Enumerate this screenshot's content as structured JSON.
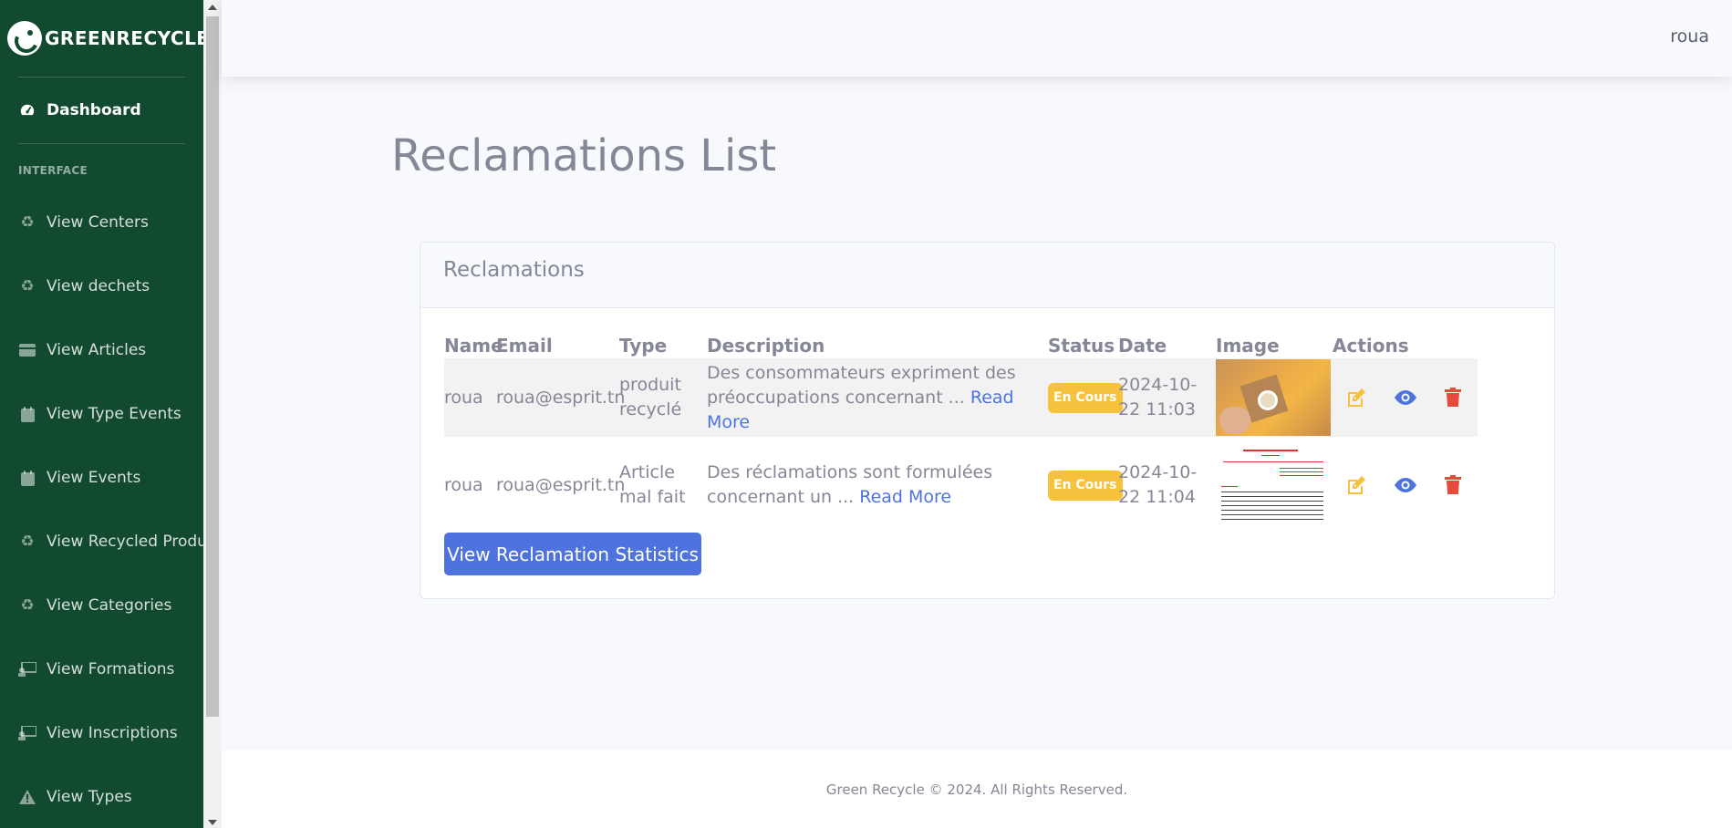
{
  "brand": {
    "name": "GREENRECYCLE"
  },
  "sidebar": {
    "dashboard": "Dashboard",
    "heading": "INTERFACE",
    "items": [
      {
        "label": "View Centers",
        "icon": "recycle-icon"
      },
      {
        "label": "View dechets",
        "icon": "recycle-icon"
      },
      {
        "label": "View Articles",
        "icon": "card-icon"
      },
      {
        "label": "View Type Events",
        "icon": "calendar-icon"
      },
      {
        "label": "View Events",
        "icon": "calendar-icon"
      },
      {
        "label": "View Recycled Products",
        "icon": "recycle-icon"
      },
      {
        "label": "View Categories",
        "icon": "recycle-icon"
      },
      {
        "label": "View Formations",
        "icon": "chalkboard-icon"
      },
      {
        "label": "View Inscriptions",
        "icon": "chalkboard-icon"
      },
      {
        "label": "View Types",
        "icon": "warning-icon"
      }
    ]
  },
  "topbar": {
    "user": "roua"
  },
  "page": {
    "title": "Reclamations List"
  },
  "card": {
    "title": "Reclamations",
    "columns": [
      "Name",
      "Email",
      "Type",
      "Description",
      "Status",
      "Date",
      "Image",
      "Actions"
    ],
    "rows": [
      {
        "name": "roua",
        "email": "roua@esprit.tn",
        "type": "produit recyclé",
        "description": "Des consommateurs expriment des préoccupations concernant ...",
        "read_more": "Read More",
        "status": "En Cours",
        "date": "2024-10-22 11:03"
      },
      {
        "name": "roua",
        "email": "roua@esprit.tn",
        "type": "Article mal fait",
        "description": "Des réclamations sont formulées concernant un ...",
        "read_more": "Read More",
        "status": "En Cours",
        "date": "2024-10-22 11:04"
      }
    ],
    "stats_button": "View Reclamation Statistics"
  },
  "footer": {
    "text": "Green Recycle © 2024. All Rights Reserved."
  },
  "colors": {
    "sidebar": "#124a2f",
    "primary": "#4e73df",
    "warning": "#f6c23e",
    "danger": "#e74a3b"
  }
}
